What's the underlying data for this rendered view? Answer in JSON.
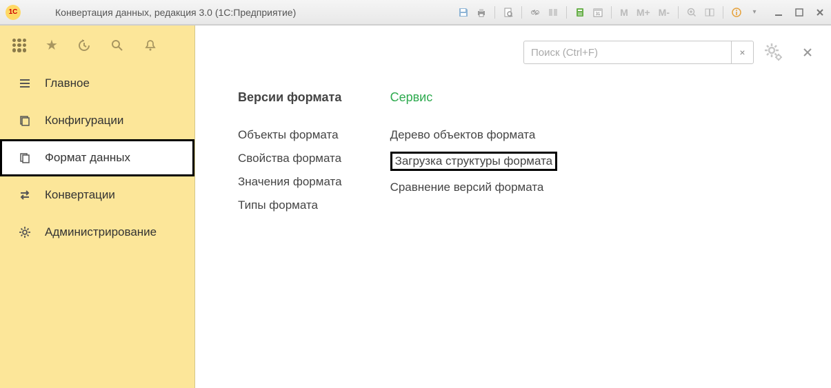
{
  "title": "Конвертация данных, редакция 3.0  (1С:Предприятие)",
  "toolbar_text": {
    "m": "M",
    "mplus": "M+",
    "mminus": "M-"
  },
  "search": {
    "placeholder": "Поиск (Ctrl+F)",
    "clear": "×"
  },
  "sidebar": {
    "items": [
      {
        "label": "Главное"
      },
      {
        "label": "Конфигурации"
      },
      {
        "label": "Формат данных"
      },
      {
        "label": "Конвертации"
      },
      {
        "label": "Администрирование"
      }
    ]
  },
  "main": {
    "col1": {
      "heading": "Версии формата",
      "items": [
        "Объекты формата",
        "Свойства формата",
        "Значения формата",
        "Типы формата"
      ]
    },
    "col2": {
      "heading": "Сервис",
      "items": [
        "Дерево объектов формата",
        "Загрузка структуры формата",
        "Сравнение версий формата"
      ]
    }
  }
}
